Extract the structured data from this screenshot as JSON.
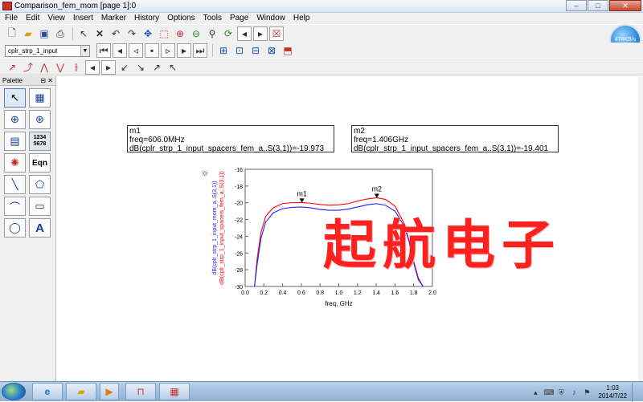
{
  "window": {
    "title": "Comparison_fem_mom [page 1]:0"
  },
  "menu": [
    "File",
    "Edit",
    "View",
    "Insert",
    "Marker",
    "History",
    "Options",
    "Tools",
    "Page",
    "Window",
    "Help"
  ],
  "toolbar2": {
    "combo_value": "cplr_strp_1_input"
  },
  "speed_badge": "474KB/s",
  "palette": {
    "title": "Palette",
    "buttons": [
      "select",
      "table",
      "polar",
      "smith",
      "list",
      "1234\n5678",
      "antenna",
      "Eqn",
      "line",
      "polygon",
      "polyline",
      "rectangle",
      "circle",
      "A"
    ]
  },
  "markers": {
    "m1": {
      "name": "m1",
      "freq": "freq=606.0MHz",
      "value": "dB(cplr_strp_1_input_spacers_fem_a..S(3,1))=-19.973"
    },
    "m2": {
      "name": "m2",
      "freq": "freq=1.406GHz",
      "value": "dB(cplr_strp_1_input_spacers_fem_a..S(3,1))=-19.401"
    }
  },
  "watermark": "起航电子",
  "chart_data": {
    "type": "line",
    "xlabel": "freq, GHz",
    "ylabel_blue": "dB(cplr_strp_1_input_mom_a..S(3,1))",
    "ylabel_red": "dB(cplr_strp_1_input_spacers_fem_a..S(3,1))",
    "xlim": [
      0.0,
      2.0
    ],
    "ylim": [
      -30,
      -16
    ],
    "xticks": [
      "0.0",
      "0.2",
      "0.4",
      "0.6",
      "0.8",
      "1.0",
      "1.2",
      "1.4",
      "1.6",
      "1.8",
      "2.0"
    ],
    "yticks": [
      "-16",
      "-18",
      "-20",
      "-22",
      "-24",
      "-26",
      "-28",
      "-30"
    ],
    "series": [
      {
        "name": "dB(cplr_strp_1_input_spacers_fem_a..S(3,1))",
        "color": "#ff0000",
        "x": [
          0.1,
          0.13,
          0.17,
          0.22,
          0.3,
          0.4,
          0.5,
          0.606,
          0.7,
          0.8,
          0.9,
          1.0,
          1.1,
          1.2,
          1.3,
          1.406,
          1.5,
          1.6,
          1.7,
          1.75,
          1.8,
          1.85,
          1.9
        ],
        "y": [
          -30,
          -26.5,
          -23.5,
          -21.6,
          -20.6,
          -20.1,
          -19.98,
          -19.97,
          -20.05,
          -20.2,
          -20.3,
          -20.25,
          -20.1,
          -19.8,
          -19.55,
          -19.4,
          -19.6,
          -20.4,
          -22.5,
          -24.5,
          -27.0,
          -29.0,
          -30
        ]
      },
      {
        "name": "dB(cplr_strp_1_input_mom_a..S(3,1))",
        "color": "#2020ff",
        "x": [
          0.1,
          0.13,
          0.17,
          0.22,
          0.3,
          0.4,
          0.5,
          0.6,
          0.7,
          0.8,
          0.9,
          1.0,
          1.1,
          1.2,
          1.3,
          1.4,
          1.5,
          1.6,
          1.7,
          1.75,
          1.8,
          1.85,
          1.9
        ],
        "y": [
          -30,
          -27.2,
          -24.2,
          -22.3,
          -21.2,
          -20.7,
          -20.55,
          -20.5,
          -20.6,
          -20.8,
          -20.9,
          -20.9,
          -20.75,
          -20.5,
          -20.25,
          -20.1,
          -20.3,
          -21.0,
          -22.8,
          -24.6,
          -27.2,
          -29.2,
          -30
        ]
      }
    ],
    "markers": [
      {
        "label": "m1",
        "x": 0.606,
        "y": -19.973
      },
      {
        "label": "m2",
        "x": 1.406,
        "y": -19.401
      }
    ]
  },
  "taskbar": {
    "time": "1:03",
    "date": "2014/7/22"
  }
}
